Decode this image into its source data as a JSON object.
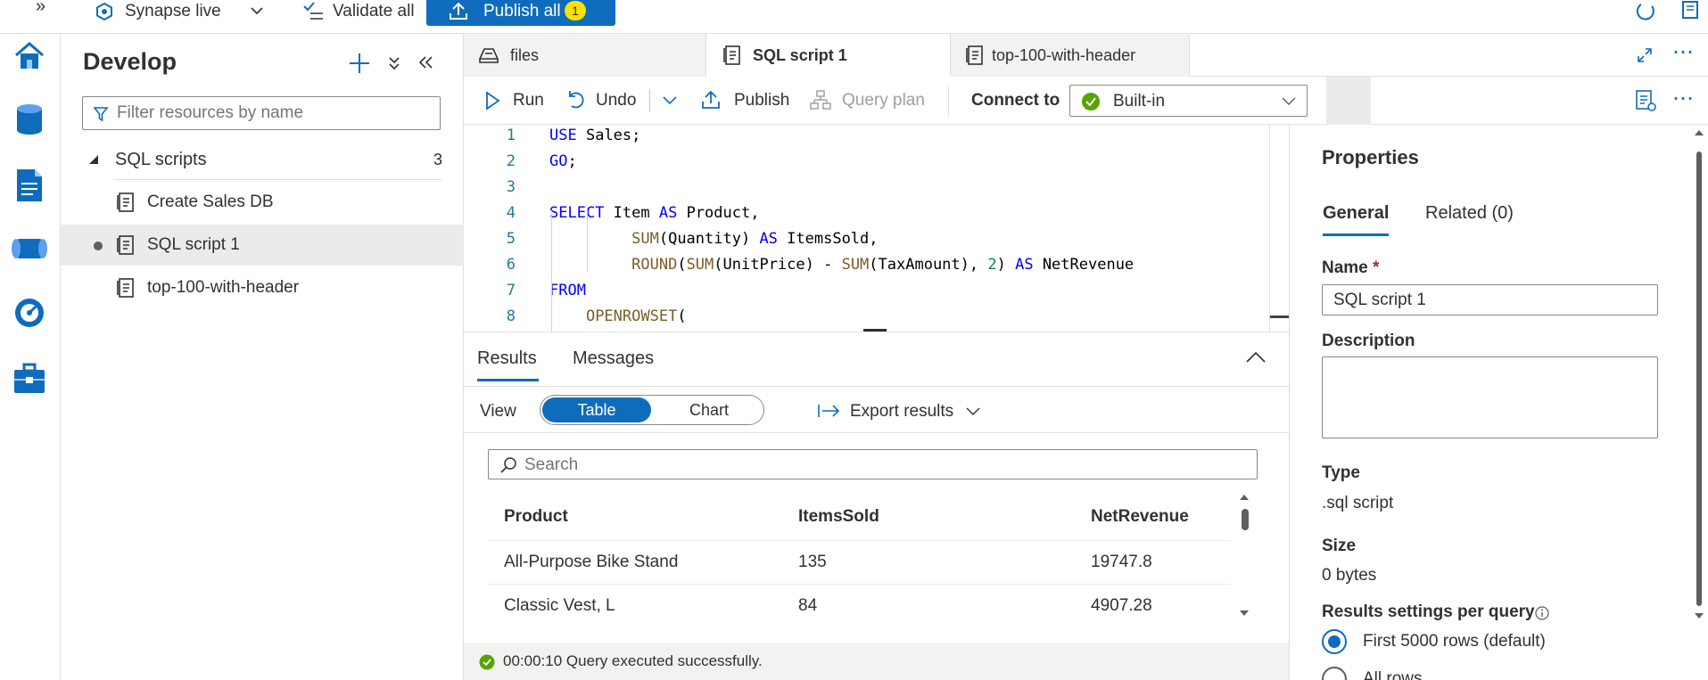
{
  "topbar": {
    "workspace_mode": "Synapse live",
    "validate_all": "Validate all",
    "publish_all": "Publish all",
    "publish_count": "1"
  },
  "develop": {
    "title": "Develop",
    "filter_placeholder": "Filter resources by name",
    "section": {
      "label": "SQL scripts",
      "count": "3"
    },
    "items": [
      {
        "label": "Create Sales DB"
      },
      {
        "label": "SQL script 1"
      },
      {
        "label": "top-100-with-header"
      }
    ]
  },
  "tabs": [
    {
      "label": "files"
    },
    {
      "label": "SQL script 1"
    },
    {
      "label": "top-100-with-header"
    }
  ],
  "toolbar": {
    "run": "Run",
    "undo": "Undo",
    "publish": "Publish",
    "query_plan": "Query plan",
    "connect_to": "Connect to",
    "connection": "Built-in"
  },
  "editor": {
    "line_numbers": [
      "1",
      "2",
      "3",
      "4",
      "5",
      "6",
      "7",
      "8"
    ],
    "lines": [
      [
        {
          "t": "USE",
          "c": "kw"
        },
        {
          "t": " Sales;",
          "c": ""
        }
      ],
      [
        {
          "t": "GO",
          "c": "kw"
        },
        {
          "t": ";",
          "c": ""
        }
      ],
      [],
      [
        {
          "t": "SELECT",
          "c": "kw"
        },
        {
          "t": " Item ",
          "c": ""
        },
        {
          "t": "AS",
          "c": "kw"
        },
        {
          "t": " Product,",
          "c": ""
        }
      ],
      [
        {
          "t": "         ",
          "c": ""
        },
        {
          "t": "SUM",
          "c": "fn"
        },
        {
          "t": "(Quantity) ",
          "c": ""
        },
        {
          "t": "AS",
          "c": "kw"
        },
        {
          "t": " ItemsSold,",
          "c": ""
        }
      ],
      [
        {
          "t": "         ",
          "c": ""
        },
        {
          "t": "ROUND",
          "c": "fn"
        },
        {
          "t": "(",
          "c": ""
        },
        {
          "t": "SUM",
          "c": "fn"
        },
        {
          "t": "(UnitPrice) - ",
          "c": ""
        },
        {
          "t": "SUM",
          "c": "fn"
        },
        {
          "t": "(TaxAmount), ",
          "c": ""
        },
        {
          "t": "2",
          "c": "num"
        },
        {
          "t": ") ",
          "c": ""
        },
        {
          "t": "AS",
          "c": "kw"
        },
        {
          "t": " NetRevenue",
          "c": ""
        }
      ],
      [
        {
          "t": "FROM",
          "c": "kw"
        }
      ],
      [
        {
          "t": "    ",
          "c": ""
        },
        {
          "t": "OPENROWSET",
          "c": "fn"
        },
        {
          "t": "(",
          "c": ""
        }
      ]
    ]
  },
  "results": {
    "tab_results": "Results",
    "tab_messages": "Messages",
    "view_label": "View",
    "view_table": "Table",
    "view_chart": "Chart",
    "export": "Export results",
    "search_placeholder": "Search",
    "columns": [
      "Product",
      "ItemsSold",
      "NetRevenue"
    ],
    "rows": [
      [
        "All-Purpose Bike Stand",
        "135",
        "19747.8"
      ],
      [
        "Classic Vest, L",
        "84",
        "4907.28"
      ]
    ],
    "status": "00:00:10 Query executed successfully."
  },
  "properties": {
    "title": "Properties",
    "tab_general": "General",
    "tab_related": "Related (0)",
    "name_label": "Name",
    "required_mark": "*",
    "name_value": "SQL script 1",
    "description_label": "Description",
    "type_label": "Type",
    "type_value": ".sql script",
    "size_label": "Size",
    "size_value": "0 bytes",
    "results_settings_label": "Results settings per query",
    "option_first": "First 5000 rows (default)",
    "option_all": "All rows"
  },
  "colors": {
    "accent": "#0f6cbd",
    "success": "#57a300",
    "badge": "#fce100"
  }
}
